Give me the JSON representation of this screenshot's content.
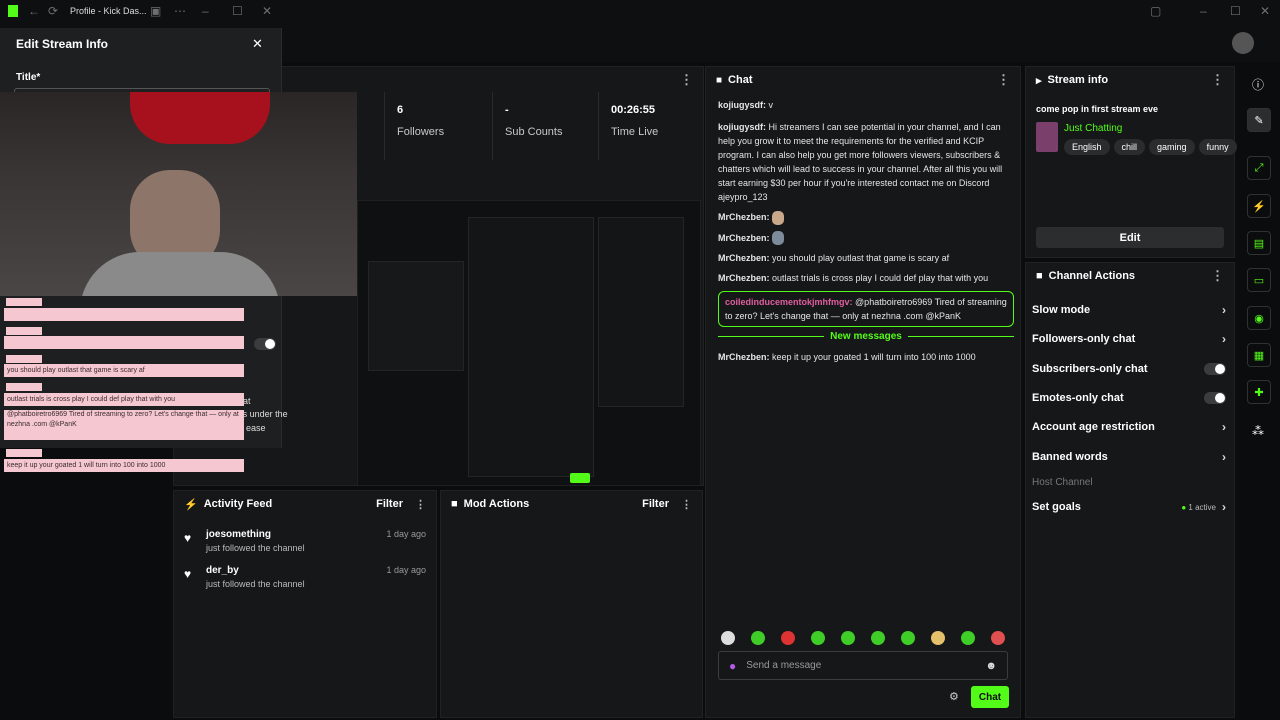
{
  "window": {
    "tab_title": "Profile - Kick Das...",
    "accent": "#53fc18"
  },
  "edit_modal": {
    "title": "Edit Stream Info",
    "title_field_label": "Title*",
    "partial_text_1": "nappropriate for audiences under the",
    "partial_text_2": "ease",
    "partial_text_3": "hat"
  },
  "stats": [
    {
      "value": "6",
      "label": "Followers"
    },
    {
      "value": "-",
      "label": "Sub Counts"
    },
    {
      "value": "00:26:55",
      "label": "Time Live"
    }
  ],
  "chat": {
    "title": "Chat",
    "messages": [
      {
        "user": "kojiugysdf:",
        "text": "v",
        "style": "normal"
      },
      {
        "user": "kojiugysdf:",
        "text": "Hi streamers I can see potential in your channel, and I can help you grow it to meet the requirements for the verified and KCIP program. I can also help you get more followers viewers, subscribers & chatters which will lead to success in your channel. After all this you will start earning $30 per hour if you're interested contact me on Discord ajeypro_123",
        "style": "normal"
      },
      {
        "user": "MrChezben:",
        "text": "",
        "style": "emote"
      },
      {
        "user": "MrChezben:",
        "text": "",
        "style": "emote"
      },
      {
        "user": "MrChezben:",
        "text": "you should play outlast that game is scary af",
        "style": "normal"
      },
      {
        "user": "MrChezben:",
        "text": "outlast trials is cross play I could def play that with you",
        "style": "normal"
      }
    ],
    "highlight": {
      "user": "coiledinducementokjmhfmgv:",
      "text": "@phatboiretro6969 Tired of streaming to zero? Let's change that — only at nezhna .com @kPanK"
    },
    "new_messages_label": "New messages",
    "after_message": {
      "user": "MrChezben:",
      "text": "keep it up your goated 1 will turn into 100 into 1000"
    },
    "input_placeholder": "Send a message",
    "send_label": "Chat"
  },
  "stream_info": {
    "title": "Stream info",
    "stream_title": "come pop in first stream eve",
    "category": "Just Chatting",
    "tags": [
      "English",
      "chill",
      "gaming",
      "funny"
    ],
    "edit_label": "Edit"
  },
  "channel_actions": {
    "title": "Channel Actions",
    "items": [
      {
        "label": "Slow mode",
        "control": "chevron"
      },
      {
        "label": "Followers-only chat",
        "control": "chevron"
      },
      {
        "label": "Subscribers-only chat",
        "control": "toggle"
      },
      {
        "label": "Emotes-only chat",
        "control": "toggle"
      },
      {
        "label": "Account age restriction",
        "control": "chevron"
      },
      {
        "label": "Banned words",
        "control": "chevron"
      },
      {
        "label": "Host Channel",
        "control": "none"
      },
      {
        "label": "Set goals",
        "control": "chevron",
        "badge": "1 active"
      }
    ]
  },
  "activity_feed": {
    "title": "Activity Feed",
    "filter_label": "Filter",
    "items": [
      {
        "name": "joesomething",
        "action": "just followed the channel",
        "time": "1 day ago"
      },
      {
        "name": "der_by",
        "action": "just followed the channel",
        "time": "1 day ago"
      }
    ]
  },
  "mod_actions": {
    "title": "Mod Actions",
    "filter_label": "Filter"
  },
  "overlay_chat": [
    "you should play outlast that game is scary af",
    "outlast trials is cross play I could def play that with you",
    "@phatboiretro6969 Tired of streaming to zero? Let's change that — only at nezhna .com @kPanK",
    "keep it up your goated 1 will turn into 100 into 1000"
  ]
}
